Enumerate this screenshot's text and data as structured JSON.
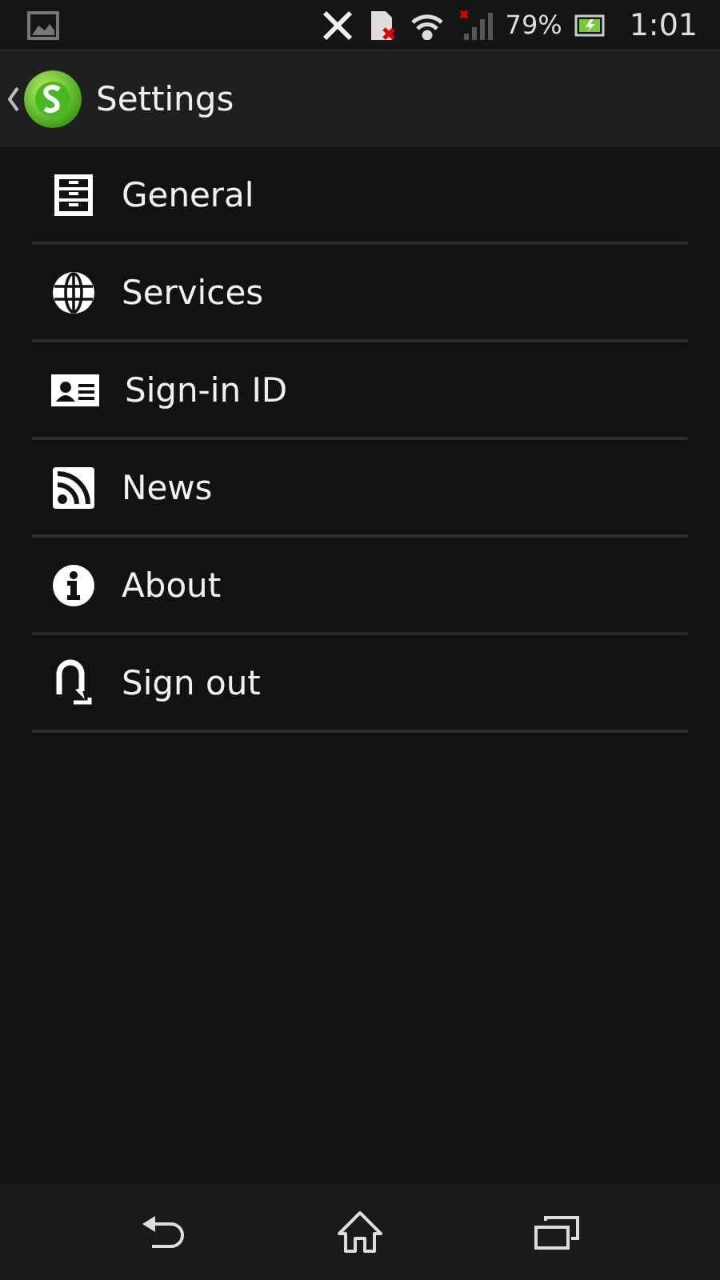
{
  "status_bar": {
    "battery": "79%",
    "time": "1:01"
  },
  "action_bar": {
    "title": "Settings"
  },
  "menu": [
    {
      "label": "General"
    },
    {
      "label": "Services"
    },
    {
      "label": "Sign-in ID"
    },
    {
      "label": "News"
    },
    {
      "label": "About"
    },
    {
      "label": "Sign out"
    }
  ]
}
